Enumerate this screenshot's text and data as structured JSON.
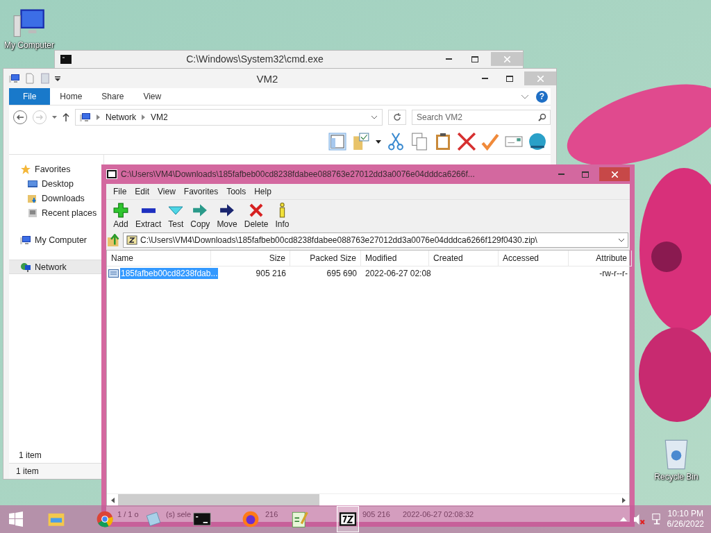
{
  "desktop_icons": [
    {
      "label": "My Computer",
      "kind": "computer"
    },
    {
      "label": "Recycle Bin",
      "kind": "recycle"
    }
  ],
  "cmd_window": {
    "title": "C:\\Windows\\System32\\cmd.exe"
  },
  "explorer": {
    "title": "VM2",
    "ribbon_tabs": [
      {
        "label": "File",
        "selected": true
      },
      {
        "label": "Home",
        "selected": false
      },
      {
        "label": "Share",
        "selected": false
      },
      {
        "label": "View",
        "selected": false
      }
    ],
    "breadcrumb": [
      "Network",
      "VM2"
    ],
    "help_label": "?",
    "search": {
      "placeholder": "Search VM2"
    },
    "nav": [
      {
        "label": "Favorites",
        "kind": "star",
        "selected": false,
        "children": [
          {
            "label": "Desktop",
            "kind": "desktop",
            "selected": false
          },
          {
            "label": "Downloads",
            "kind": "downloads",
            "selected": false
          },
          {
            "label": "Recent places",
            "kind": "recent",
            "selected": false
          }
        ]
      },
      {
        "label": "My Computer",
        "kind": "computer",
        "selected": false
      },
      {
        "label": "Network",
        "kind": "network",
        "selected": true
      }
    ],
    "pane_status": "1 item",
    "status_bar": "1 item"
  },
  "archive": {
    "title": "C:\\Users\\VM4\\Downloads\\185fafbeb00cd8238fdabee088763e27012dd3a0076e04dddca6266f...",
    "menu": [
      "File",
      "Edit",
      "View",
      "Favorites",
      "Tools",
      "Help"
    ],
    "toolbar": [
      {
        "label": "Add",
        "kind": "add"
      },
      {
        "label": "Extract",
        "kind": "extract"
      },
      {
        "label": "Test",
        "kind": "test"
      },
      {
        "label": "Copy",
        "kind": "copy"
      },
      {
        "label": "Move",
        "kind": "move"
      },
      {
        "label": "Delete",
        "kind": "delete"
      },
      {
        "label": "Info",
        "kind": "info"
      }
    ],
    "path": "C:\\Users\\VM4\\Downloads\\185fafbeb00cd8238fdabee088763e27012dd3a0076e04dddca6266f129f0430.zip\\",
    "columns": [
      "Name",
      "Size",
      "Packed Size",
      "Modified",
      "Created",
      "Accessed",
      "Attribute"
    ],
    "rows": [
      {
        "selected": true,
        "cells": [
          "185fafbeb00cd8238fdab...",
          "905 216",
          "695 690",
          "2022-06-27 02:08",
          "",
          "",
          "-rw-r--r-"
        ]
      }
    ],
    "status": [
      "1 / 1 o",
      "(s) sele",
      "216",
      "905 216",
      "2022-06-27 02:08:32"
    ]
  },
  "taskbar": {
    "apps": [
      {
        "kind": "explorer",
        "selected": false
      },
      {
        "kind": "chrome",
        "selected": false
      },
      {
        "kind": "notepad",
        "selected": false
      },
      {
        "kind": "cmd",
        "selected": false
      },
      {
        "kind": "firefox",
        "selected": false
      },
      {
        "kind": "notepadpp",
        "selected": false
      },
      {
        "kind": "sevenzip",
        "selected": true
      }
    ],
    "time": "10:10 PM",
    "date": "6/26/2022"
  }
}
